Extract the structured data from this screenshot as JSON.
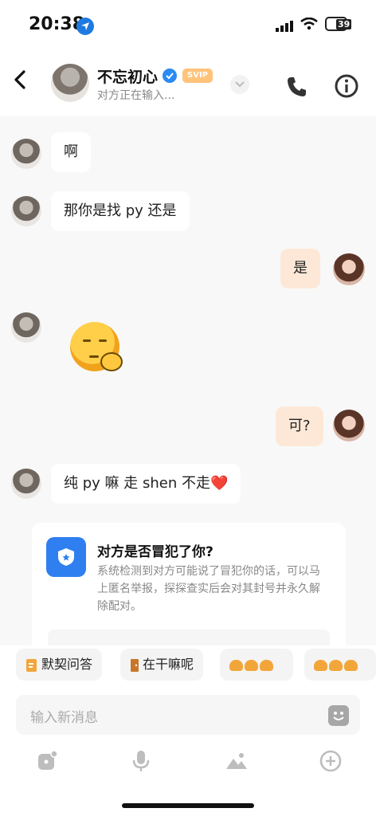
{
  "status_bar": {
    "time": "20:38",
    "battery": "39"
  },
  "header": {
    "contact_name": "不忘初心",
    "badge": "SVIP",
    "typing_status": "对方正在输入..."
  },
  "messages": [
    {
      "side": "them",
      "text": "啊"
    },
    {
      "side": "them",
      "text": "那你是找 py 还是"
    },
    {
      "side": "me",
      "text": "是"
    },
    {
      "side": "them",
      "type": "sticker"
    },
    {
      "side": "me",
      "text": "可?"
    },
    {
      "side": "them",
      "text": "纯 py 嘛 走 shen 不走",
      "emoji": "❤️"
    }
  ],
  "safety_card": {
    "title": "对方是否冒犯了你?",
    "description": "系统检测到对方可能说了冒犯你的话，可以马上匿名举报，探探查实后会对其封号并永久解除配对。"
  },
  "quick_replies": [
    {
      "label": "默契问答",
      "icon": "quiz-icon"
    },
    {
      "label": "在干嘛呢",
      "icon": "door-icon"
    },
    {
      "label": "",
      "icon": "sticker-icon"
    },
    {
      "label": "",
      "icon": "sticker-icon"
    }
  ],
  "input": {
    "placeholder": "输入新消息"
  },
  "toolbar": [
    "dice-icon",
    "microphone-icon",
    "image-icon",
    "plus-icon"
  ],
  "colors": {
    "accent_blue": "#2f7ff0",
    "bubble_me": "#fde8d7",
    "svip": "#ffc37a"
  }
}
